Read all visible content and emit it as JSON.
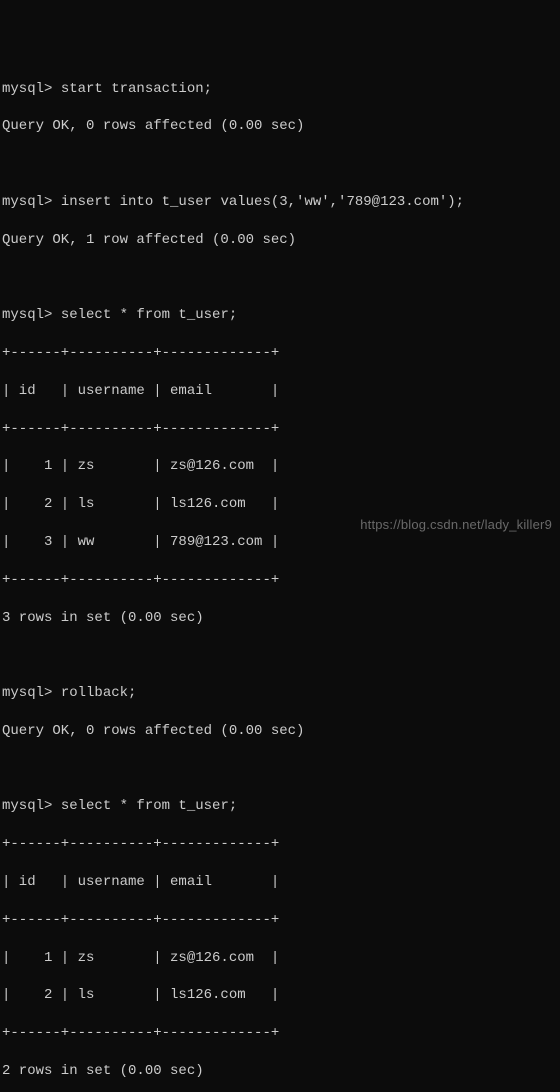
{
  "prompt": "mysql> ",
  "session": [
    {
      "command": "start transaction;",
      "response": "Query OK, 0 rows affected (0.00 sec)"
    },
    {
      "command": "insert into t_user values(3,'ww','789@123.com');",
      "response": "Query OK, 1 row affected (0.00 sec)"
    },
    {
      "command": "select * from t_user;",
      "table": {
        "columns": [
          "id",
          "username",
          "email"
        ],
        "rows": [
          {
            "id": 1,
            "username": "zs",
            "email": "zs@126.com"
          },
          {
            "id": 2,
            "username": "ls",
            "email": "ls126.com"
          },
          {
            "id": 3,
            "username": "ww",
            "email": "789@123.com"
          }
        ]
      },
      "footer": "3 rows in set (0.00 sec)"
    },
    {
      "command": "rollback;",
      "response": "Query OK, 0 rows affected (0.00 sec)"
    },
    {
      "command": "select * from t_user;",
      "table": {
        "columns": [
          "id",
          "username",
          "email"
        ],
        "rows": [
          {
            "id": 1,
            "username": "zs",
            "email": "zs@126.com"
          },
          {
            "id": 2,
            "username": "ls",
            "email": "ls126.com"
          }
        ]
      },
      "footer": "2 rows in set (0.00 sec)"
    }
  ],
  "table_render": {
    "border": "+------+----------+-------------+",
    "header": "| id   | username | email       |",
    "row_fmt_widths": [
      4,
      8,
      11
    ]
  },
  "watermark": "https://blog.csdn.net/lady_killer9"
}
